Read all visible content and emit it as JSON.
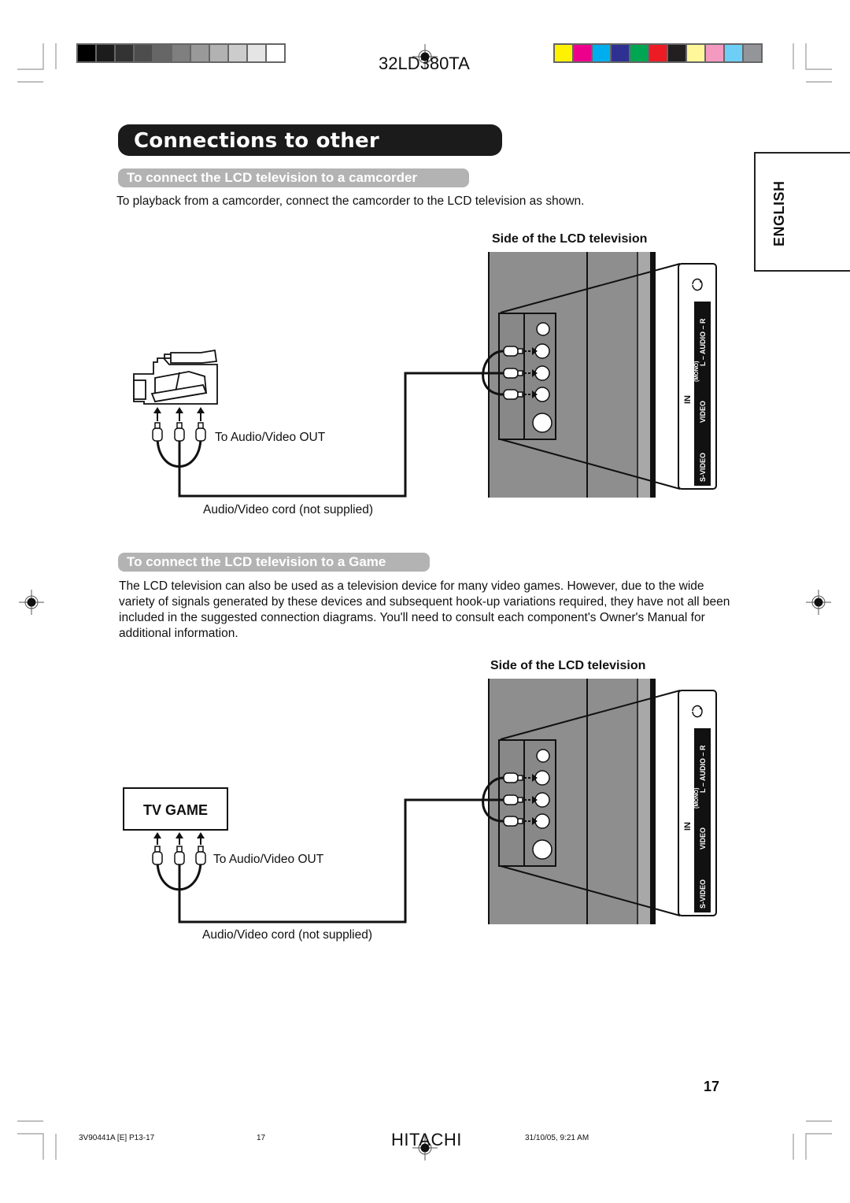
{
  "header": {
    "model": "32LD380TA",
    "gray_swatches": [
      "#000000",
      "#1c1c1c",
      "#333333",
      "#4d4d4d",
      "#666666",
      "#7f7f7f",
      "#999999",
      "#b2b2b2",
      "#cccccc",
      "#e5e5e5",
      "#ffffff"
    ],
    "color_swatches": [
      "#fff200",
      "#ec008c",
      "#00aeef",
      "#2e3192",
      "#00a651",
      "#ed1c24",
      "#231f20",
      "#fff799",
      "#f49ac1",
      "#6dcff6",
      "#939598"
    ]
  },
  "language_tab": "ENGLISH",
  "page_title": "Connections to other equipment",
  "sections": [
    {
      "heading": "To connect the LCD television to a camcorder",
      "body": "To playback from a camcorder, connect the camcorder to the LCD television as shown.",
      "diagram": {
        "tv_side_label": "Side of the LCD television",
        "device": "camcorder",
        "output_label": "To Audio/Video OUT",
        "cord_label": "Audio/Video cord (not supplied)",
        "panel_labels": {
          "in": "IN",
          "audio": "L – AUDIO – R",
          "mono": "(MONO)",
          "video": "VIDEO",
          "svideo": "S-VIDEO"
        }
      }
    },
    {
      "heading": "To connect the LCD television to a Game",
      "body": "The LCD television can also be used as a television device for many video games. However, due to the wide variety of signals generated by these devices and subsequent hook-up variations required, they have not all been included in the suggested connection diagrams. You'll need to consult each component's Owner's Manual for additional information.",
      "diagram": {
        "tv_side_label": "Side of the LCD television",
        "device": "TV GAME",
        "output_label": "To Audio/Video OUT",
        "cord_label": "Audio/Video cord (not supplied)",
        "panel_labels": {
          "in": "IN",
          "audio": "L – AUDIO – R",
          "mono": "(MONO)",
          "video": "VIDEO",
          "svideo": "S-VIDEO"
        }
      }
    }
  ],
  "page_number": "17",
  "footer": {
    "doc_code": "3V90441A [E] P13-17",
    "page": "17",
    "brand": "HITACHI",
    "timestamp": "31/10/05, 9:21 AM"
  }
}
